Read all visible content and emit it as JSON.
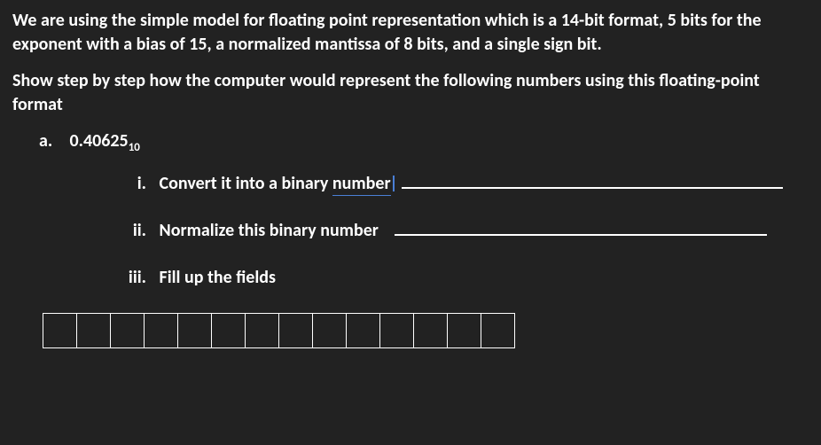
{
  "intro_p1": "We are using the simple model for floating point representation which is a 14-bit format, 5 bits for the exponent with a bias of 15, a normalized mantissa of 8 bits, and a single sign bit.",
  "intro_p2": "Show step by step how the computer would represent the following numbers using this floating-point format",
  "item_a": {
    "label": "a.",
    "value": "0.40625",
    "subscript": "10"
  },
  "roman": {
    "i": {
      "label": "i.",
      "text_prefix": "Convert it into a binary ",
      "underlined": "number"
    },
    "ii": {
      "label": "ii.",
      "text": "Normalize this binary number"
    },
    "iii": {
      "label": "iii.",
      "text": "Fill up the fields"
    }
  },
  "bit_count": 14
}
